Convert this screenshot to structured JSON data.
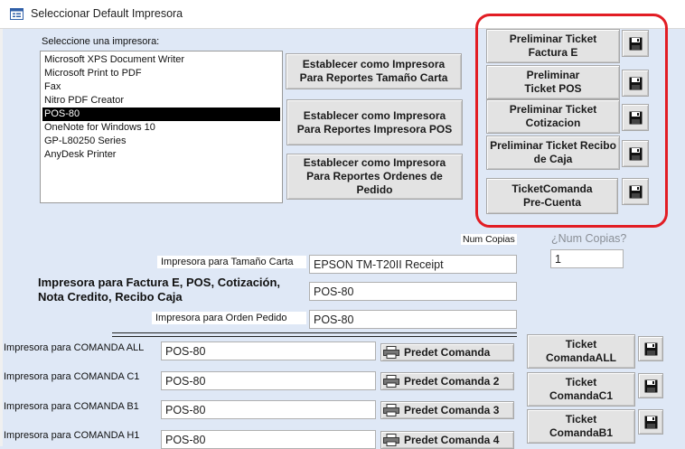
{
  "window": {
    "title": "Seleccionar Default Impresora"
  },
  "printers": {
    "label": "Seleccione una impresora:",
    "items": [
      {
        "label": "Microsoft XPS Document Writer",
        "selected": false
      },
      {
        "label": "Microsoft Print to PDF",
        "selected": false
      },
      {
        "label": "Fax",
        "selected": false
      },
      {
        "label": "Nitro PDF Creator",
        "selected": false
      },
      {
        "label": "POS-80",
        "selected": true
      },
      {
        "label": "OneNote for Windows 10",
        "selected": false
      },
      {
        "label": "GP-L80250 Series",
        "selected": false
      },
      {
        "label": "AnyDesk Printer",
        "selected": false
      }
    ]
  },
  "actions": {
    "carta": "Establecer como Impresora Para Reportes Tamaño Carta",
    "pos": "Establecer como Impresora Para Reportes Impresora POS",
    "ordenes": "Establecer como Impresora Para Reportes Ordenes de Pedido"
  },
  "preliminar": [
    {
      "label": "Preliminar Ticket Factura E"
    },
    {
      "label": "Preliminar Ticket POS"
    },
    {
      "label": "Preliminar Ticket Cotizacion"
    },
    {
      "label": "Preliminar Ticket Recibo de Caja"
    },
    {
      "label": "TicketComanda Pre-Cuenta"
    }
  ],
  "copies": {
    "label": "Num Copias",
    "question": "¿Num Copias?",
    "value": "1"
  },
  "assignments": {
    "carta_label": "Impresora para Tamaño Carta",
    "carta_value": "EPSON TM-T20II Receipt",
    "factura_label": "Impresora para Factura E, POS, Cotización, Nota Credito, Recibo Caja",
    "factura_value": "POS-80",
    "pedido_label": "Impresora para Orden Pedido",
    "pedido_value": "POS-80"
  },
  "comandas": [
    {
      "label": "Impresora para COMANDA ALL",
      "value": "POS-80",
      "button": "Predet Comanda",
      "ticket": "Ticket ComandaALL"
    },
    {
      "label": "Impresora para COMANDA C1",
      "value": "POS-80",
      "button": "Predet Comanda 2",
      "ticket": "Ticket ComandaC1"
    },
    {
      "label": "Impresora para COMANDA B1",
      "value": "POS-80",
      "button": "Predet Comanda 3",
      "ticket": "Ticket ComandaB1"
    },
    {
      "label": "Impresora para COMANDA H1",
      "value": "POS-80",
      "button": "Predet Comanda 4",
      "ticket": ""
    }
  ],
  "icons": {
    "save": "floppy-disk-icon",
    "printer": "printer-icon",
    "app": "form-icon"
  },
  "colors": {
    "background": "#dfe8f6",
    "highlight": "#e21d24",
    "selection": "#000000"
  }
}
